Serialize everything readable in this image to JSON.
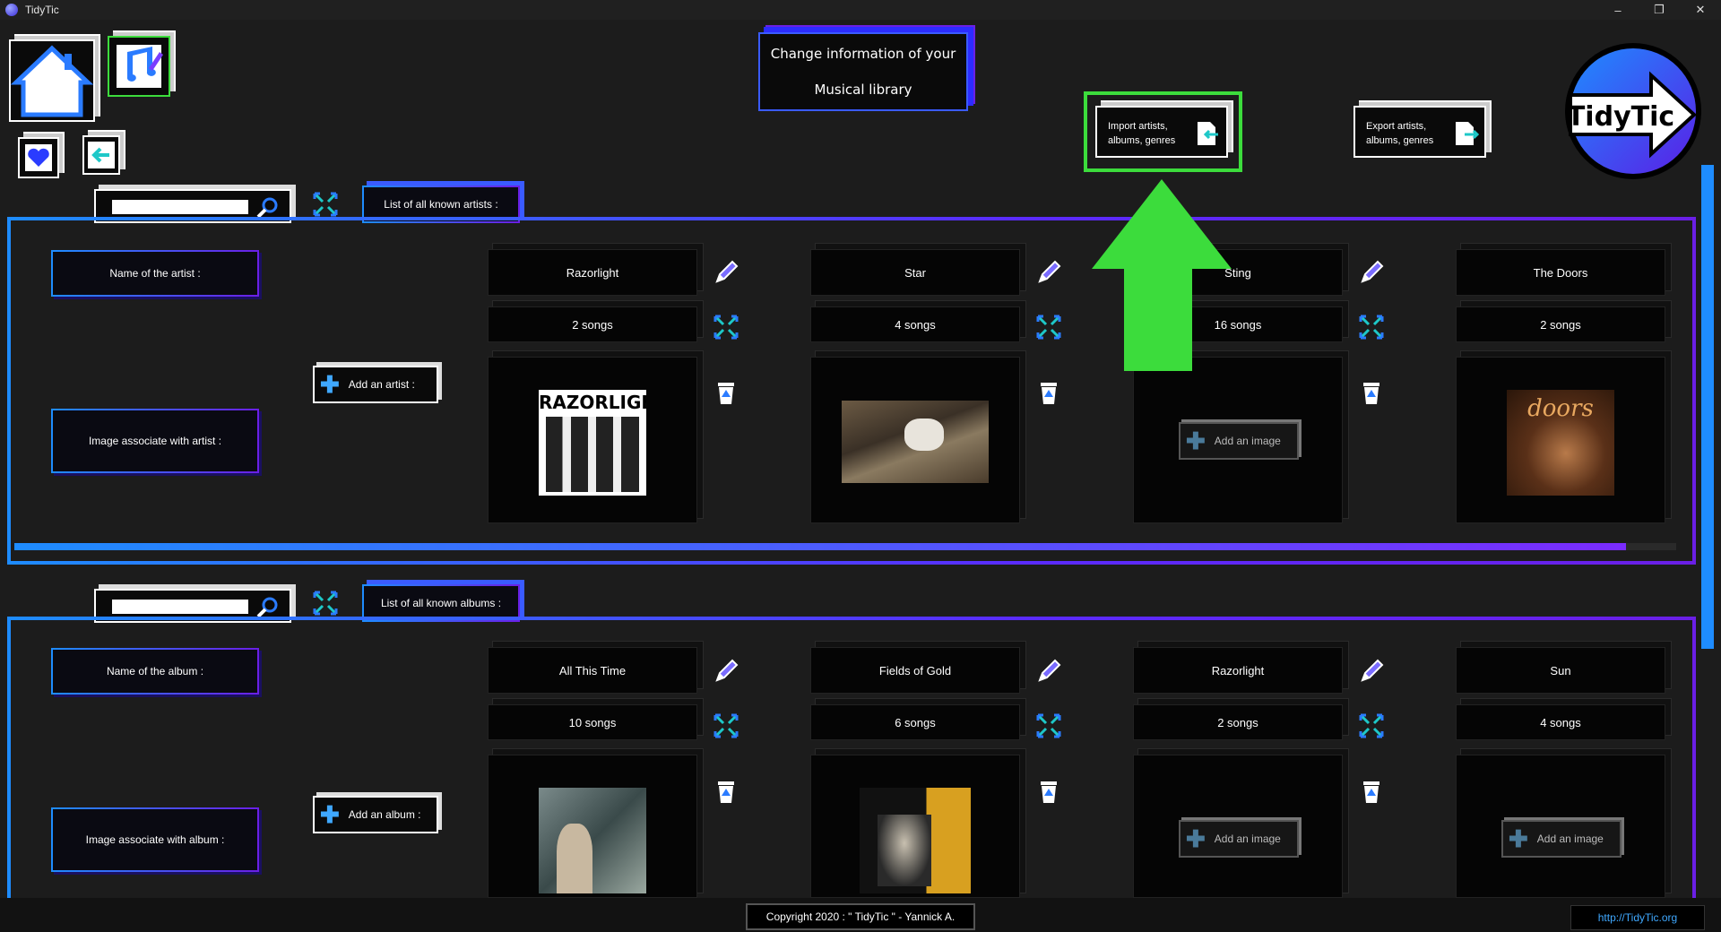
{
  "window": {
    "title": "TidyTic",
    "controls": [
      "–",
      "❐",
      "✕"
    ]
  },
  "header": {
    "title_line1": "Change information of your",
    "title_line2": "Musical library",
    "import_label_1": "Import artists,",
    "import_label_2": "albums, genres",
    "export_label_1": "Export artists,",
    "export_label_2": "albums, genres",
    "logo_text": "TidyTic"
  },
  "artists": {
    "search_placeholder": "",
    "list_label": "List of all known artists :",
    "name_label": "Name of the artist :",
    "image_label": "Image associate with artist :",
    "add_label": "Add an artist :",
    "scroll_progress": 0.97,
    "items": [
      {
        "name": "Razorlight",
        "songs": "2 songs",
        "image": "band-photo"
      },
      {
        "name": "Star",
        "songs": "4 songs",
        "image": "field-photo"
      },
      {
        "name": "Sting",
        "songs": "16 songs",
        "image": ""
      },
      {
        "name": "The Doors",
        "songs": "2 songs",
        "image": "doors-cover"
      }
    ]
  },
  "albums": {
    "search_placeholder": "",
    "list_label": "List of all known albums :",
    "name_label": "Name of the album :",
    "image_label": "Image associate with album :",
    "add_label": "Add an album :",
    "items": [
      {
        "name": "All This Time",
        "songs": "10 songs",
        "image": "sting-cover"
      },
      {
        "name": "Fields of Gold",
        "songs": "6 songs",
        "image": "fields-cover"
      },
      {
        "name": "Razorlight",
        "songs": "2 songs",
        "image": ""
      },
      {
        "name": "Sun",
        "songs": "4 songs",
        "image": ""
      }
    ]
  },
  "add_image_label": "Add an image",
  "footer": {
    "copyright": "Copyright 2020 : \" TidyTic \" - Yannick A.",
    "link": "http://TidyTic.org"
  },
  "colors": {
    "accent_blue": "#1e8cff",
    "accent_purple": "#6a1fe6",
    "highlight_green": "#3cdc3c"
  }
}
